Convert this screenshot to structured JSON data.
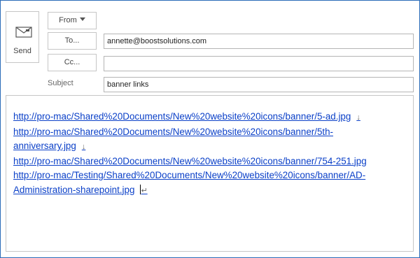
{
  "send": {
    "label": "Send",
    "icon": "envelope-icon"
  },
  "header": {
    "from_label": "From",
    "to_label": "To...",
    "cc_label": "Cc...",
    "subject_label": "Subject",
    "to_value": "annette@boostsolutions.com",
    "cc_value": "",
    "subject_value": "banner links"
  },
  "body": {
    "lines": [
      "http://pro-mac/Shared%20Documents/New%20website%20icons/banner/5-ad.jpg",
      "http://pro-mac/Shared%20Documents/New%20website%20icons/banner/5th-",
      "anniversary.jpg",
      "http://pro-mac/Shared%20Documents/New%20website%20icons/banner/754-251.jpg",
      "http://pro-mac/Testing/Shared%20Documents/New%20website%20icons/banner/AD-",
      "Administration-sharepoint.jpg"
    ],
    "line_break_mark": "↓",
    "paragraph_mark": "↵"
  },
  "colors": {
    "link": "#0b40c8",
    "frame": "#2b6cb8",
    "border": "#c6c6c6"
  }
}
